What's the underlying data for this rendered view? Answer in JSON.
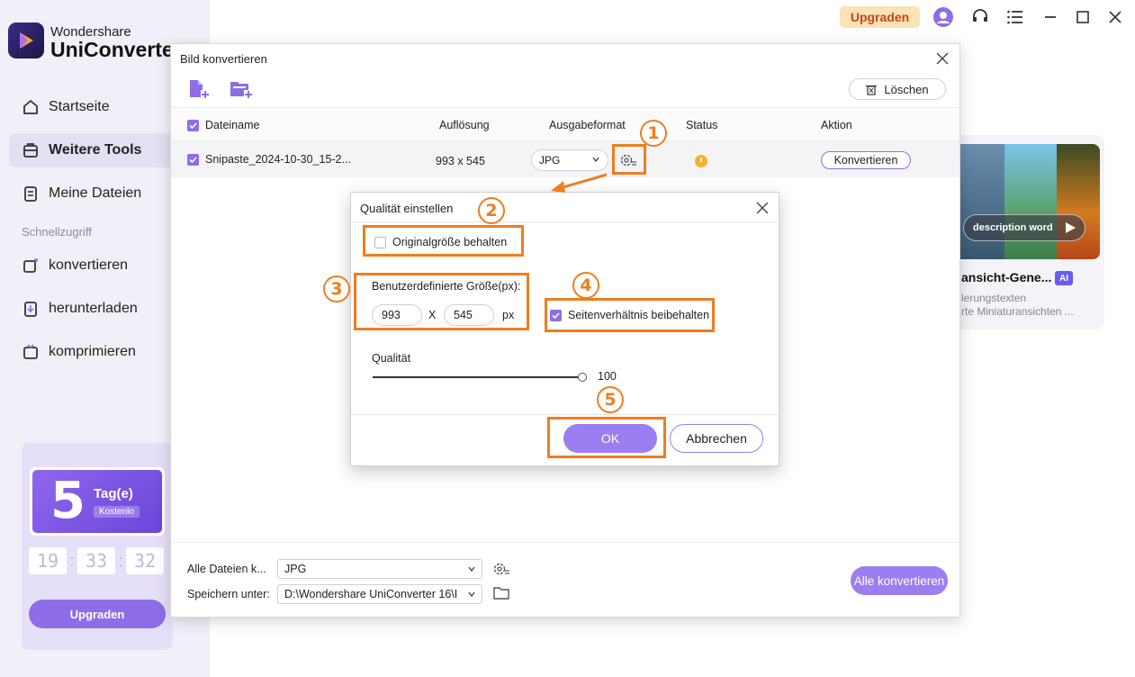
{
  "app": {
    "brand_small": "Wondershare",
    "brand_big": "UniConverter",
    "upgrade_label": "Upgraden"
  },
  "sidebar": {
    "items": [
      {
        "label": "Startseite",
        "icon": "home-icon"
      },
      {
        "label": "Weitere Tools",
        "icon": "toolbox-icon",
        "active": true
      },
      {
        "label": "Meine Dateien",
        "icon": "files-icon"
      }
    ],
    "quick_access_label": "Schnellzugriff",
    "quick_items": [
      {
        "label": "konvertieren",
        "icon": "convert-icon"
      },
      {
        "label": "herunterladen",
        "icon": "download-icon"
      },
      {
        "label": "komprimieren",
        "icon": "compress-icon"
      }
    ],
    "trial": {
      "days": "5",
      "unit": "Tag(e)",
      "free": "Kostenlo",
      "timer": [
        "19",
        "33",
        "32"
      ],
      "upgrade_label": "Upgraden"
    }
  },
  "background_card": {
    "thumb_label": "description word",
    "title": "ansicht-Gene...",
    "badge": "AI",
    "line1": "lerungstexten",
    "line2": "rte Miniaturansichten ..."
  },
  "dialog": {
    "title": "Bild konvertieren",
    "clear_label": "Löschen",
    "columns": {
      "filename": "Dateiname",
      "resolution": "Auflösung",
      "output_format": "Ausgabeformat",
      "status": "Status",
      "action": "Aktion"
    },
    "row": {
      "filename": "Snipaste_2024-10-30_15-2...",
      "resolution": "993 x 545",
      "format": "JPG",
      "convert_label": "Konvertieren"
    },
    "footer": {
      "all_files_label": "Alle Dateien k...",
      "all_files_format": "JPG",
      "save_label": "Speichern unter:",
      "save_path": "D:\\Wondershare UniConverter 16\\I",
      "convert_all_label": "Alle konvertieren"
    }
  },
  "quality_dialog": {
    "title": "Qualität einstellen",
    "keep_original_label": "Originalgröße behalten",
    "keep_original_checked": false,
    "custom_size_label": "Benutzerdefinierte Größe(px):",
    "width": "993",
    "height": "545",
    "x_sep": "X",
    "unit": "px",
    "keep_ratio_label": "Seitenverhältnis beibehalten",
    "keep_ratio_checked": true,
    "quality_label": "Qualität",
    "quality_value": "100",
    "quality_fraction": 1.0,
    "ok_label": "OK",
    "cancel_label": "Abbrechen"
  },
  "annotations": {
    "steps": [
      "1",
      "2",
      "3",
      "4",
      "5"
    ],
    "color": "#f07d1e"
  },
  "colors": {
    "accent": "#8d6ee8",
    "annotation": "#f07d1e",
    "upgrade_text": "#c8451a"
  }
}
